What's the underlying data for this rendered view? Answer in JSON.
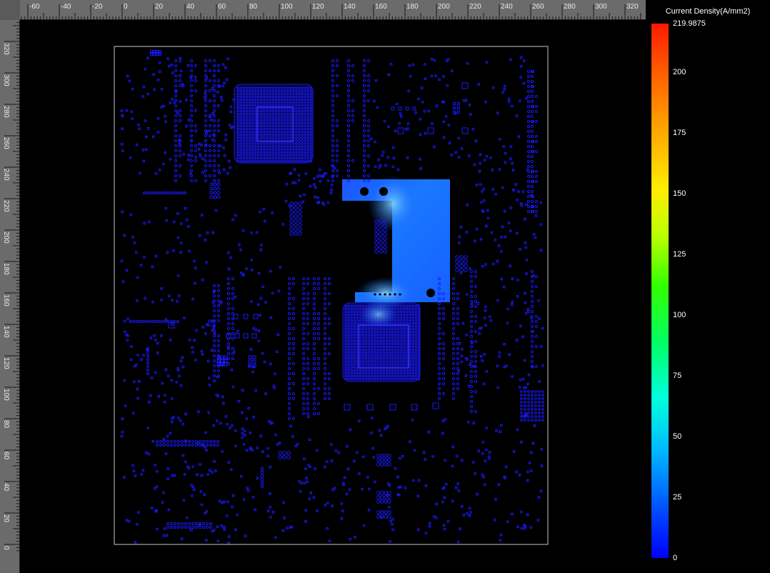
{
  "app": {
    "legend_title": "Current Density(A/mm2)",
    "legend_ticks": [
      {
        "label": "219.9875",
        "value": 219.9875
      },
      {
        "label": "200",
        "value": 200
      },
      {
        "label": "175",
        "value": 175
      },
      {
        "label": "150",
        "value": 150
      },
      {
        "label": "125",
        "value": 125
      },
      {
        "label": "100",
        "value": 100
      },
      {
        "label": "75",
        "value": 75
      },
      {
        "label": "50",
        "value": 50
      },
      {
        "label": "25",
        "value": 25
      },
      {
        "label": "0",
        "value": 0
      }
    ],
    "legend_range": [
      0,
      219.9875
    ],
    "ruler_x_labels": [
      "-60",
      "-40",
      "-20",
      "0",
      "20",
      "40",
      "60",
      "80",
      "100",
      "120",
      "140",
      "160",
      "180",
      "200",
      "220",
      "240",
      "260",
      "280",
      "300",
      "320"
    ],
    "ruler_y_labels": [
      "320",
      "300",
      "280",
      "260",
      "240",
      "220",
      "200",
      "180",
      "160",
      "140",
      "120",
      "100",
      "80",
      "60",
      "40",
      "20",
      "0"
    ],
    "colors": {
      "background": "#000000",
      "ruler": "#6b6b6b",
      "via_blue": "#1a1aff",
      "plane_blue": "#1566ff",
      "board_outline": "#c8c8c8"
    }
  }
}
